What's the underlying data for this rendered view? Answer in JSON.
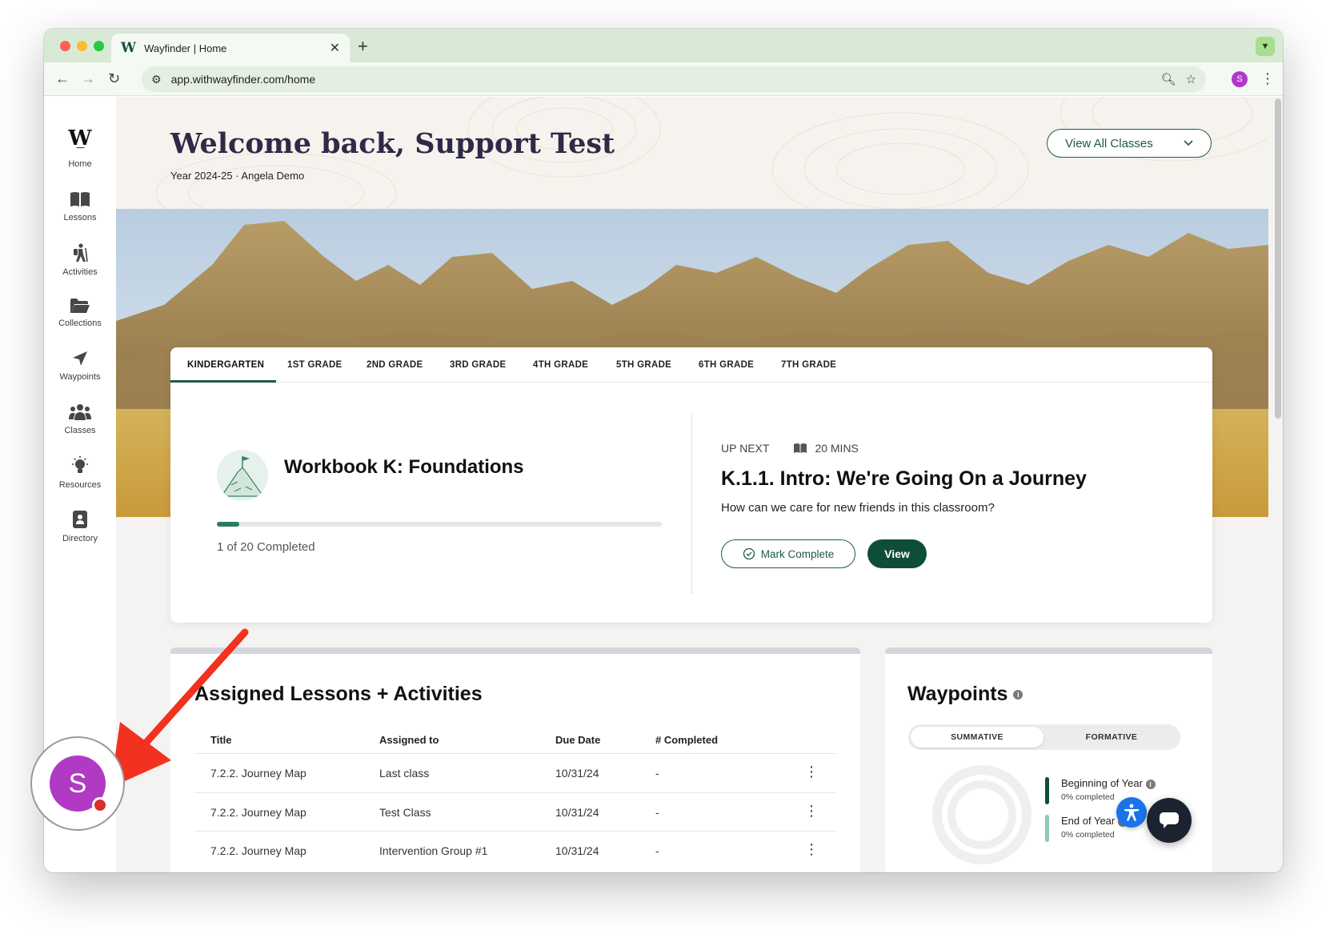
{
  "browser": {
    "tab_title": "Wayfinder | Home",
    "tab_favicon": "W",
    "url": "app.withwayfinder.com/home",
    "profile_initial": "S"
  },
  "sidebar": {
    "logo_letter": "W",
    "items": [
      {
        "label": "Home",
        "icon": "wayfinder-logo-icon"
      },
      {
        "label": "Lessons",
        "icon": "book-icon"
      },
      {
        "label": "Activities",
        "icon": "hiker-icon"
      },
      {
        "label": "Collections",
        "icon": "folder-icon"
      },
      {
        "label": "Waypoints",
        "icon": "navigation-arrow-icon"
      },
      {
        "label": "Classes",
        "icon": "users-icon"
      },
      {
        "label": "Resources",
        "icon": "lightbulb-icon"
      },
      {
        "label": "Directory",
        "icon": "contact-book-icon"
      }
    ]
  },
  "header": {
    "welcome": "Welcome back, Support Test",
    "subline": "Year 2024-25 · Angela Demo",
    "classes_button": "View All Classes"
  },
  "grades": {
    "tabs": [
      "KINDERGARTEN",
      "1ST GRADE",
      "2ND GRADE",
      "3RD GRADE",
      "4TH GRADE",
      "5TH GRADE",
      "6TH GRADE",
      "7TH GRADE"
    ],
    "active_tab": "KINDERGARTEN"
  },
  "workbook": {
    "title": "Workbook K: Foundations",
    "progress_text": "1 of 20 Completed",
    "progress_fraction": 0.05
  },
  "up_next": {
    "label": "UP NEXT",
    "duration": "20 MINS",
    "lesson_title": "K.1.1. Intro: We're Going On a Journey",
    "question": "How can we care for new friends in this classroom?",
    "mark_complete": "Mark Complete",
    "view": "View"
  },
  "assigned": {
    "title": "Assigned Lessons + Activities",
    "columns": [
      "Title",
      "Assigned to",
      "Due Date",
      "# Completed"
    ],
    "rows": [
      {
        "title": "7.2.2. Journey Map",
        "assigned_to": "Last class",
        "due": "10/31/24",
        "completed": "-"
      },
      {
        "title": "7.2.2. Journey Map",
        "assigned_to": "Test Class",
        "due": "10/31/24",
        "completed": "-"
      },
      {
        "title": "7.2.2. Journey Map",
        "assigned_to": "Intervention Group #1",
        "due": "10/31/24",
        "completed": "-"
      }
    ]
  },
  "waypoints": {
    "title": "Waypoints",
    "tabs": [
      "SUMMATIVE",
      "FORMATIVE"
    ],
    "active_tab": "SUMMATIVE",
    "legend": [
      {
        "name": "Beginning of Year",
        "sub": "0% completed",
        "color": "#0e4e39",
        "value": 0
      },
      {
        "name": "End of Year",
        "sub": "0% completed",
        "color": "#8fc9b1",
        "value": 0
      }
    ]
  },
  "overlay": {
    "avatar_initial": "S",
    "avatar_color": "#b03ac4",
    "arrow_color": "#f2321e"
  }
}
